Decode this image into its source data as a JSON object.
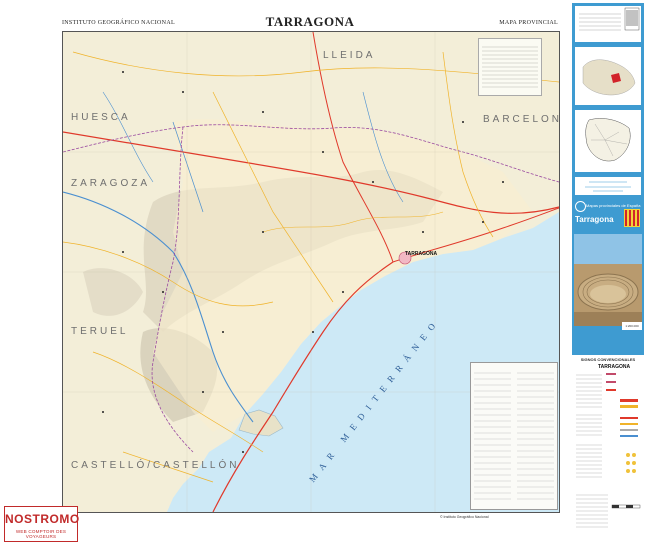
{
  "header": {
    "publisher": "INSTITUTO GEOGRÁFICO NACIONAL",
    "title": "TARRAGONA",
    "series": "MAPA PROVINCIAL"
  },
  "map": {
    "regions": {
      "huesca": "HUESCA",
      "lleida": "LLEIDA",
      "barcelona": "BARCELONA",
      "zaragoza": "ZARAGOZA",
      "teruel": "TERUEL",
      "castello": "CASTELLÓ/CASTELLÓN"
    },
    "sea": "MAR MEDITERRÁNEO",
    "city": "TARRAGONA",
    "colors": {
      "sea": "#cde9f6",
      "land": "#f3eed8",
      "mountain": "#c9c3b0",
      "road_major": "#e0392b",
      "road_minor": "#f0b32a",
      "river": "#4a8fd0"
    }
  },
  "side_panel": {
    "brand_subtitle": "Mapas provinciales de España",
    "brand_title": "Tarragona",
    "legend_heading": "SIGNOS CONVENCIONALES",
    "legend_city": "TARRAGONA",
    "scale": "1:200.000"
  },
  "watermark": {
    "name": "NOSTROMO",
    "subtitle": "WEB COMPTOIR DES VOYAGEURS"
  },
  "footer": {
    "text": "© Instituto Geográfico Nacional"
  }
}
